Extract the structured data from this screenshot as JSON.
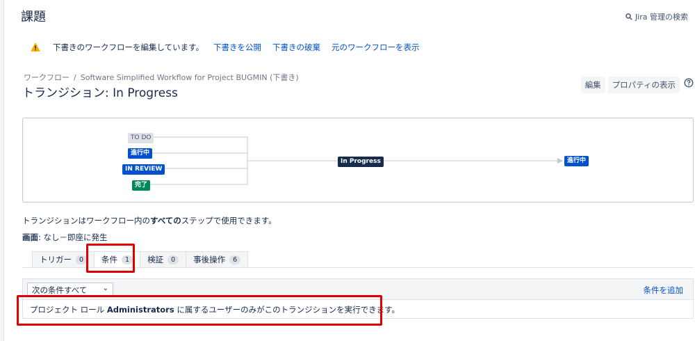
{
  "page": {
    "heading": "課題",
    "admin_search": "Jira 管理の検索"
  },
  "draft_bar": {
    "message": "下書きのワークフローを編集しています。",
    "publish": "下書きを公開",
    "discard": "下書きの破棄",
    "view_original": "元のワークフローを表示"
  },
  "breadcrumb": {
    "root": "ワークフロー",
    "separator": "/",
    "current": "Software Simplified Workflow for Project BUGMIN (下書き)"
  },
  "title": "トランジション: In Progress",
  "actions": {
    "edit": "編集",
    "properties": "プロパティの表示"
  },
  "diagram": {
    "sources": [
      {
        "label": "TO DO",
        "color": "#dfe1e6"
      },
      {
        "label": "進行中",
        "color": "#0052cc"
      },
      {
        "label": "IN REVIEW",
        "color": "#0052cc"
      },
      {
        "label": "完了",
        "color": "#00875a"
      }
    ],
    "transition": "In Progress",
    "target": "進行中"
  },
  "info": {
    "prefix": "トランジションはワークフロー内の",
    "bold": "すべての",
    "suffix": "ステップで使用できます。"
  },
  "screen": {
    "label": "画面",
    "value": ": なし－即座に発生"
  },
  "tabs": [
    {
      "label": "トリガー",
      "count": "0"
    },
    {
      "label": "条件",
      "count": "1"
    },
    {
      "label": "検証",
      "count": "0"
    },
    {
      "label": "事後操作",
      "count": "6"
    }
  ],
  "conditions": {
    "select_value": "次の条件すべて",
    "add_link": "条件を追加",
    "row_prefix": "プロジェクト ロール ",
    "row_bold": "Administrators",
    "row_suffix": " に属するユーザーのみがこのトランジションを実行できます。"
  },
  "colors": {
    "link": "#0052cc",
    "highlight": "#e00000",
    "warning": "#ffab00"
  }
}
